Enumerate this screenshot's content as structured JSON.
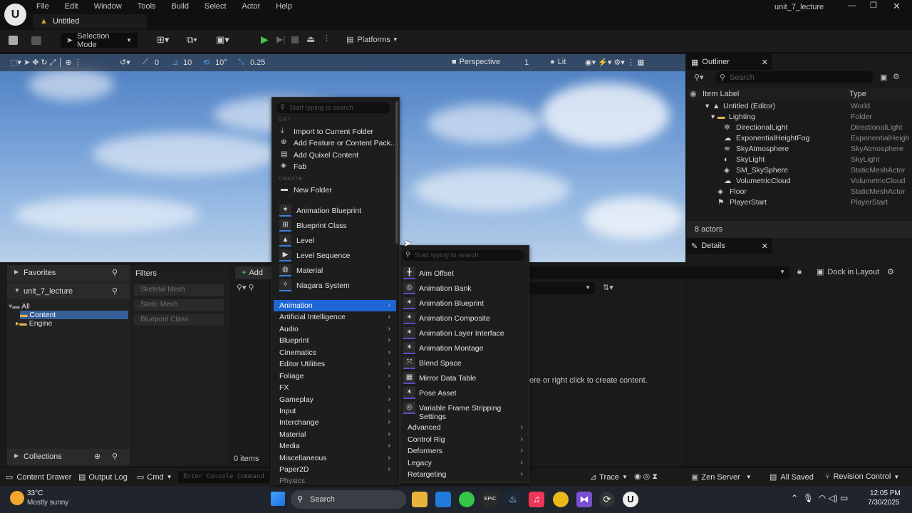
{
  "titlebar": {
    "menu": [
      "File",
      "Edit",
      "Window",
      "Tools",
      "Build",
      "Select",
      "Actor",
      "Help"
    ],
    "tab": "Untitled",
    "project": "unit_7_lecture"
  },
  "toolbar": {
    "mode": "Selection Mode",
    "platforms": "Platforms"
  },
  "viewport": {
    "snap_rot": "0",
    "snap_grid": "10",
    "snap_angle": "10°",
    "scale": "0.25",
    "view": "Perspective",
    "view_count": "1",
    "lit": "Lit"
  },
  "outliner": {
    "title": "Outliner",
    "search_placeholder": "Search",
    "col_label": "Item Label",
    "col_type": "Type",
    "rows": [
      {
        "label": "Untitled (Editor)",
        "type": "World"
      },
      {
        "label": "Lighting",
        "type": "Folder"
      },
      {
        "label": "DirectionalLight",
        "type": "DirectionalLight"
      },
      {
        "label": "ExponentialHeightFog",
        "type": "ExponentialHeigh"
      },
      {
        "label": "SkyAtmosphere",
        "type": "SkyAtmosphere"
      },
      {
        "label": "SkyLight",
        "type": "SkyLight"
      },
      {
        "label": "SM_SkySphere",
        "type": "StaticMeshActor"
      },
      {
        "label": "VolumetricCloud",
        "type": "VolumetricCloud"
      },
      {
        "label": "Floor",
        "type": "StaticMeshActor"
      },
      {
        "label": "PlayerStart",
        "type": "PlayerStart"
      }
    ],
    "count": "8 actors"
  },
  "details": {
    "title": "Details",
    "dock": "Dock in Layout"
  },
  "content_browser": {
    "favorites": "Favorites",
    "project": "unit_7_lecture",
    "tree": [
      "All",
      "Content",
      "Engine"
    ],
    "filters": "Filters",
    "filter_chips": [
      "Skeletal Mesh",
      "Static Mesh",
      "Blueprint Class"
    ],
    "add": "Add",
    "items": "0 items",
    "collections": "Collections",
    "empty_hint": "ere or right click to create content."
  },
  "menu": {
    "search_placeholder": "Start typing to search",
    "get_label": "GET",
    "create_label": "CREATE",
    "get": [
      "Import to Current Folder",
      "Add Feature or Content Pack...",
      "Add Quixel Content",
      "Fab"
    ],
    "new_folder": "New Folder",
    "create": [
      "Animation Blueprint",
      "Blueprint Class",
      "Level",
      "Level Sequence",
      "Material",
      "Niagara System"
    ],
    "categories": [
      "Animation",
      "Artificial Intelligence",
      "Audio",
      "Blueprint",
      "Cinematics",
      "Editor Utilities",
      "Foliage",
      "FX",
      "Gameplay",
      "Input",
      "Interchange",
      "Material",
      "Media",
      "Miscellaneous",
      "Paper2D",
      "Physics"
    ]
  },
  "submenu": {
    "search_placeholder": "Start typing to search",
    "items": [
      "Aim Offset",
      "Animation Bank",
      "Animation Blueprint",
      "Animation Composite",
      "Animation Layer Interface",
      "Animation Montage",
      "Blend Space",
      "Mirror Data Table",
      "Pose Asset",
      "Variable Frame Stripping Settings"
    ],
    "groups": [
      "Advanced",
      "Control Rig",
      "Deformers",
      "Legacy",
      "Retargeting"
    ]
  },
  "bottombar": {
    "content_drawer": "Content Drawer",
    "output_log": "Output Log",
    "cmd": "Cmd",
    "console_placeholder": "Enter Console Command",
    "trace": "Trace",
    "zen": "Zen Server",
    "saved": "All Saved",
    "revision": "Revision Control"
  },
  "taskbar": {
    "temp": "33°C",
    "weather": "Mostly sunny",
    "search": "Search",
    "time": "12:05 PM",
    "date": "7/30/2025"
  }
}
